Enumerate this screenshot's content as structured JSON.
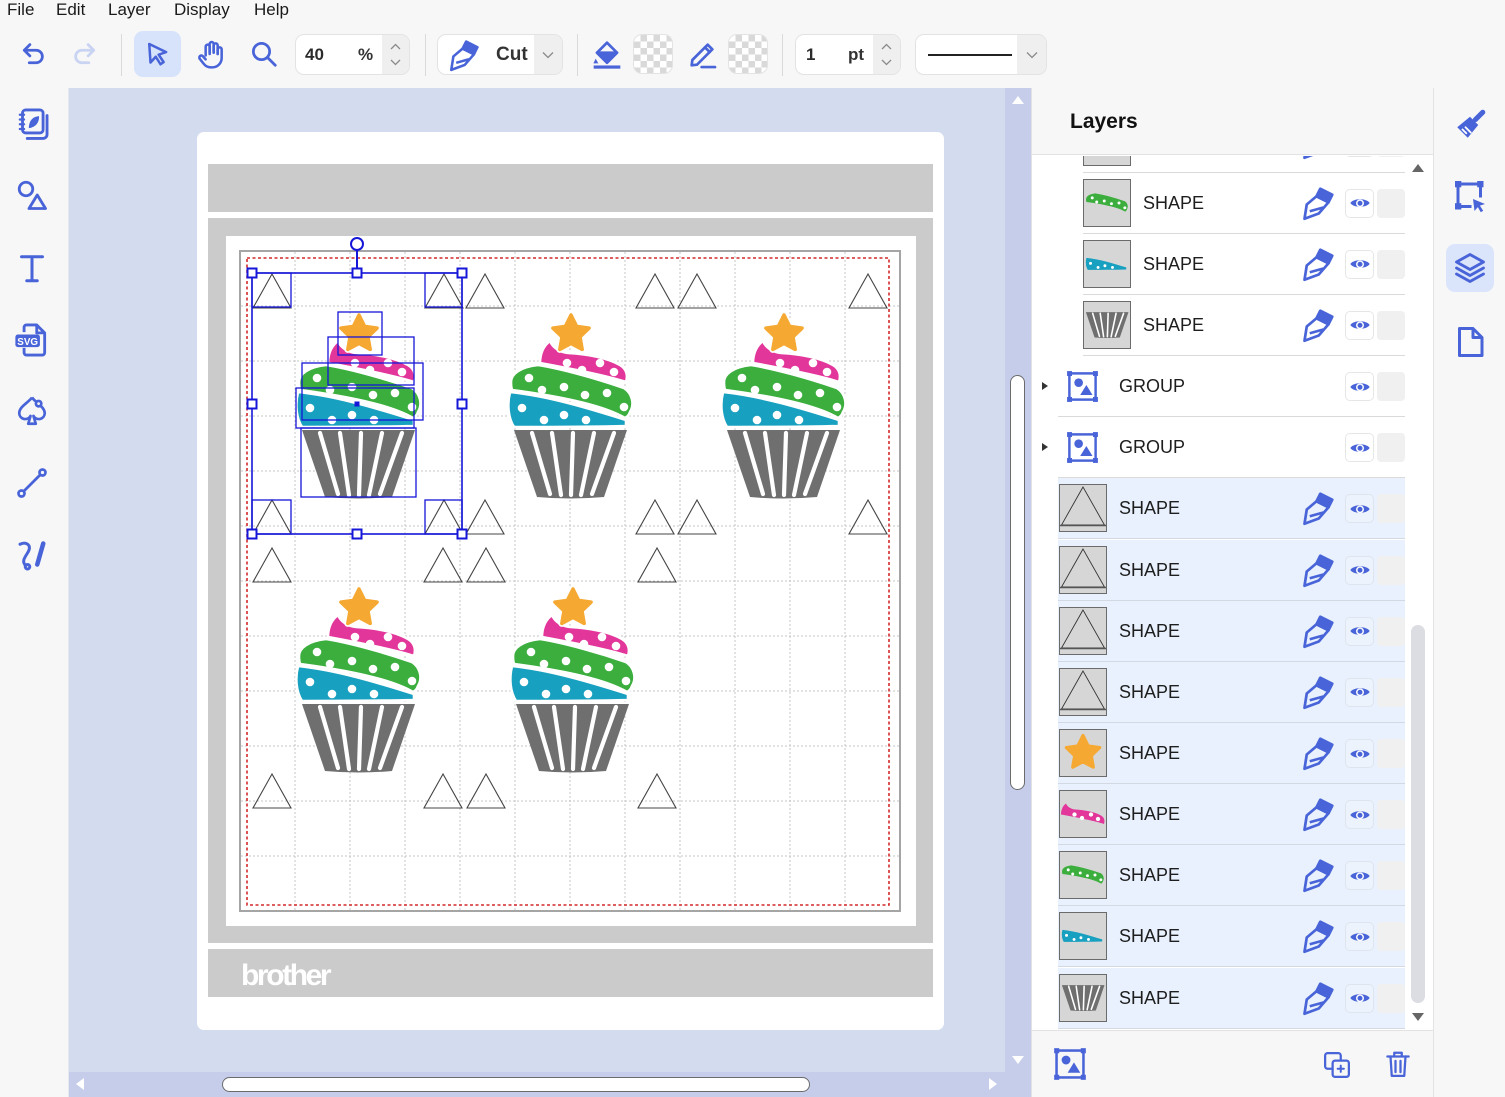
{
  "menu": [
    {
      "label": "File"
    },
    {
      "label": "Edit"
    },
    {
      "label": "Layer"
    },
    {
      "label": "Display"
    },
    {
      "label": "Help"
    }
  ],
  "toolbar": {
    "undo": {
      "icon": "undo-icon",
      "enabled": true
    },
    "redo": {
      "icon": "redo-icon",
      "enabled": false
    },
    "tools": [
      {
        "id": "select",
        "icon": "pointer-icon",
        "active": true
      },
      {
        "id": "pan",
        "icon": "hand-icon",
        "active": false
      },
      {
        "id": "zoom",
        "icon": "magnifier-icon",
        "active": false
      }
    ],
    "zoom": {
      "value": "40",
      "unit": "%"
    },
    "operation": {
      "icon": "blade-icon",
      "label": "Cut"
    },
    "fill": {
      "icon": "fill-bucket-icon",
      "color": "none"
    },
    "stroke": {
      "icon": "pencil-icon",
      "color": "none"
    },
    "stroke_width": {
      "value": "1",
      "unit": "pt"
    },
    "line_style": {
      "value": "solid"
    }
  },
  "left_sidebar": [
    {
      "id": "projects",
      "icon": "notebook-icon"
    },
    {
      "id": "shapes",
      "icon": "shapes-icon"
    },
    {
      "id": "text",
      "icon": "text-icon"
    },
    {
      "id": "svg-import",
      "icon": "svg-file-icon",
      "badge": "SVG"
    },
    {
      "id": "outline",
      "icon": "spade-outline-icon"
    },
    {
      "id": "line",
      "icon": "line-icon"
    },
    {
      "id": "freehand",
      "icon": "freehand-icon"
    }
  ],
  "canvas": {
    "brand_logo": "brother",
    "grid_visible": true,
    "selection_active": true
  },
  "layers_panel": {
    "title": "Layers",
    "rows": [
      {
        "label": "",
        "kind": "shape",
        "thumb": "blank",
        "indent": true,
        "selected": false,
        "cut": true,
        "visible": true
      },
      {
        "label": "SHAPE",
        "kind": "shape",
        "thumb": "green",
        "indent": true,
        "selected": false,
        "cut": true,
        "visible": true
      },
      {
        "label": "SHAPE",
        "kind": "shape",
        "thumb": "teal",
        "indent": true,
        "selected": false,
        "cut": true,
        "visible": true
      },
      {
        "label": "SHAPE",
        "kind": "shape",
        "thumb": "cup",
        "indent": true,
        "selected": false,
        "cut": true,
        "visible": true
      },
      {
        "label": "GROUP",
        "kind": "group",
        "expanded": false,
        "indent": false,
        "selected": false,
        "cut": false,
        "visible": true
      },
      {
        "label": "GROUP",
        "kind": "group",
        "expanded": false,
        "indent": false,
        "selected": false,
        "cut": false,
        "visible": true
      },
      {
        "label": "SHAPE",
        "kind": "shape",
        "thumb": "triangle",
        "indent": false,
        "selected": true,
        "cut": true,
        "visible": true
      },
      {
        "label": "SHAPE",
        "kind": "shape",
        "thumb": "triangle",
        "indent": false,
        "selected": true,
        "cut": true,
        "visible": true
      },
      {
        "label": "SHAPE",
        "kind": "shape",
        "thumb": "triangle",
        "indent": false,
        "selected": true,
        "cut": true,
        "visible": true
      },
      {
        "label": "SHAPE",
        "kind": "shape",
        "thumb": "triangle",
        "indent": false,
        "selected": true,
        "cut": true,
        "visible": true
      },
      {
        "label": "SHAPE",
        "kind": "shape",
        "thumb": "star",
        "indent": false,
        "selected": true,
        "cut": true,
        "visible": true
      },
      {
        "label": "SHAPE",
        "kind": "shape",
        "thumb": "pink",
        "indent": false,
        "selected": true,
        "cut": true,
        "visible": true
      },
      {
        "label": "SHAPE",
        "kind": "shape",
        "thumb": "green",
        "indent": false,
        "selected": true,
        "cut": true,
        "visible": true
      },
      {
        "label": "SHAPE",
        "kind": "shape",
        "thumb": "teal",
        "indent": false,
        "selected": true,
        "cut": true,
        "visible": true
      },
      {
        "label": "SHAPE",
        "kind": "shape",
        "thumb": "cup",
        "indent": false,
        "selected": true,
        "cut": true,
        "visible": true
      }
    ]
  },
  "layers_footer": {
    "group_icon": "group-icon",
    "duplicate_icon": "duplicate-icon",
    "delete_icon": "trash-icon"
  },
  "right_tabs": [
    {
      "id": "style",
      "icon": "paintbrush-icon",
      "active": false
    },
    {
      "id": "transform",
      "icon": "transform-select-icon",
      "active": false
    },
    {
      "id": "layers",
      "icon": "layers-icon",
      "active": true
    },
    {
      "id": "page",
      "icon": "page-icon",
      "active": false
    }
  ],
  "colors": {
    "accent": "#4864d8",
    "selection": "#1616d8",
    "cut_margin": "#d42a2a",
    "canvas_bg": "#d3dcef",
    "selected_row_bg": "#e8f1fd",
    "cupcake": {
      "star": "#f6a932",
      "pink": "#e2369b",
      "green": "#3bae3e",
      "teal": "#17a0bf",
      "cup": "#6f6f6f"
    }
  }
}
